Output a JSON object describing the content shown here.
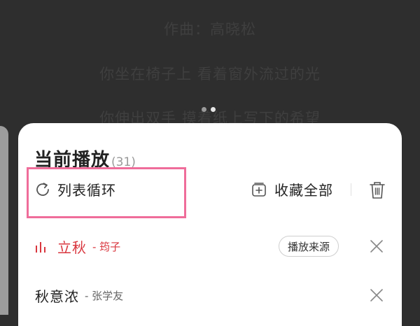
{
  "lyrics": {
    "lines": [
      "作曲：高晓松",
      "你坐在椅子上 看着窗外流过的光",
      "你伸出双手 摸着纸上写下的希望"
    ],
    "pager_active": 2,
    "pager_total": 2
  },
  "sheet": {
    "title": "当前播放",
    "count": "(31)",
    "play_mode": {
      "label": "列表循环",
      "icon": "repeat-icon"
    },
    "collect_all": {
      "label": "收藏全部",
      "icon": "add-to-folder-icon"
    },
    "delete_icon": "trash-icon"
  },
  "queue": [
    {
      "title": "立秋",
      "artist": "- 筠子",
      "playing": true,
      "source_label": "播放来源"
    },
    {
      "title": "秋意浓",
      "artist": "- 张学友",
      "playing": false
    }
  ],
  "colors": {
    "accent": "#d9363e",
    "highlight": "#ef6d9a",
    "background": "#2e2e2e"
  }
}
